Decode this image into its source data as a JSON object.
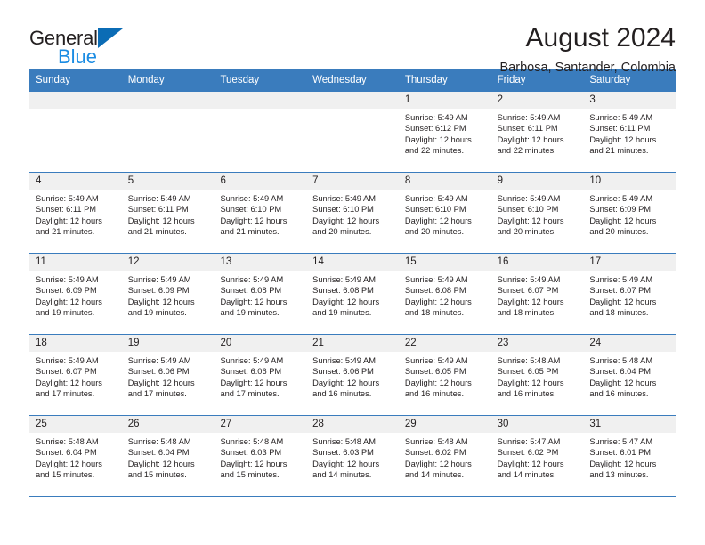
{
  "brand": {
    "name_part1": "General",
    "name_part2": "Blue",
    "flag_color": "#0b6cb5",
    "blue_text_color": "#1b8ce3"
  },
  "header": {
    "title": "August 2024",
    "subtitle": "Barbosa, Santander, Colombia"
  },
  "theme": {
    "header_band": "#3a7cbd",
    "daynum_band": "#f0f0f0",
    "text": "#231f20"
  },
  "calendar": {
    "weekdays": [
      "Sunday",
      "Monday",
      "Tuesday",
      "Wednesday",
      "Thursday",
      "Friday",
      "Saturday"
    ],
    "weeks": [
      [
        {
          "day": "",
          "sunrise": "",
          "sunset": "",
          "daylight1": "",
          "daylight2": "",
          "empty": true
        },
        {
          "day": "",
          "sunrise": "",
          "sunset": "",
          "daylight1": "",
          "daylight2": "",
          "empty": true
        },
        {
          "day": "",
          "sunrise": "",
          "sunset": "",
          "daylight1": "",
          "daylight2": "",
          "empty": true
        },
        {
          "day": "",
          "sunrise": "",
          "sunset": "",
          "daylight1": "",
          "daylight2": "",
          "empty": true
        },
        {
          "day": "1",
          "sunrise": "Sunrise: 5:49 AM",
          "sunset": "Sunset: 6:12 PM",
          "daylight1": "Daylight: 12 hours",
          "daylight2": "and 22 minutes."
        },
        {
          "day": "2",
          "sunrise": "Sunrise: 5:49 AM",
          "sunset": "Sunset: 6:11 PM",
          "daylight1": "Daylight: 12 hours",
          "daylight2": "and 22 minutes."
        },
        {
          "day": "3",
          "sunrise": "Sunrise: 5:49 AM",
          "sunset": "Sunset: 6:11 PM",
          "daylight1": "Daylight: 12 hours",
          "daylight2": "and 21 minutes."
        }
      ],
      [
        {
          "day": "4",
          "sunrise": "Sunrise: 5:49 AM",
          "sunset": "Sunset: 6:11 PM",
          "daylight1": "Daylight: 12 hours",
          "daylight2": "and 21 minutes."
        },
        {
          "day": "5",
          "sunrise": "Sunrise: 5:49 AM",
          "sunset": "Sunset: 6:11 PM",
          "daylight1": "Daylight: 12 hours",
          "daylight2": "and 21 minutes."
        },
        {
          "day": "6",
          "sunrise": "Sunrise: 5:49 AM",
          "sunset": "Sunset: 6:10 PM",
          "daylight1": "Daylight: 12 hours",
          "daylight2": "and 21 minutes."
        },
        {
          "day": "7",
          "sunrise": "Sunrise: 5:49 AM",
          "sunset": "Sunset: 6:10 PM",
          "daylight1": "Daylight: 12 hours",
          "daylight2": "and 20 minutes."
        },
        {
          "day": "8",
          "sunrise": "Sunrise: 5:49 AM",
          "sunset": "Sunset: 6:10 PM",
          "daylight1": "Daylight: 12 hours",
          "daylight2": "and 20 minutes."
        },
        {
          "day": "9",
          "sunrise": "Sunrise: 5:49 AM",
          "sunset": "Sunset: 6:10 PM",
          "daylight1": "Daylight: 12 hours",
          "daylight2": "and 20 minutes."
        },
        {
          "day": "10",
          "sunrise": "Sunrise: 5:49 AM",
          "sunset": "Sunset: 6:09 PM",
          "daylight1": "Daylight: 12 hours",
          "daylight2": "and 20 minutes."
        }
      ],
      [
        {
          "day": "11",
          "sunrise": "Sunrise: 5:49 AM",
          "sunset": "Sunset: 6:09 PM",
          "daylight1": "Daylight: 12 hours",
          "daylight2": "and 19 minutes."
        },
        {
          "day": "12",
          "sunrise": "Sunrise: 5:49 AM",
          "sunset": "Sunset: 6:09 PM",
          "daylight1": "Daylight: 12 hours",
          "daylight2": "and 19 minutes."
        },
        {
          "day": "13",
          "sunrise": "Sunrise: 5:49 AM",
          "sunset": "Sunset: 6:08 PM",
          "daylight1": "Daylight: 12 hours",
          "daylight2": "and 19 minutes."
        },
        {
          "day": "14",
          "sunrise": "Sunrise: 5:49 AM",
          "sunset": "Sunset: 6:08 PM",
          "daylight1": "Daylight: 12 hours",
          "daylight2": "and 19 minutes."
        },
        {
          "day": "15",
          "sunrise": "Sunrise: 5:49 AM",
          "sunset": "Sunset: 6:08 PM",
          "daylight1": "Daylight: 12 hours",
          "daylight2": "and 18 minutes."
        },
        {
          "day": "16",
          "sunrise": "Sunrise: 5:49 AM",
          "sunset": "Sunset: 6:07 PM",
          "daylight1": "Daylight: 12 hours",
          "daylight2": "and 18 minutes."
        },
        {
          "day": "17",
          "sunrise": "Sunrise: 5:49 AM",
          "sunset": "Sunset: 6:07 PM",
          "daylight1": "Daylight: 12 hours",
          "daylight2": "and 18 minutes."
        }
      ],
      [
        {
          "day": "18",
          "sunrise": "Sunrise: 5:49 AM",
          "sunset": "Sunset: 6:07 PM",
          "daylight1": "Daylight: 12 hours",
          "daylight2": "and 17 minutes."
        },
        {
          "day": "19",
          "sunrise": "Sunrise: 5:49 AM",
          "sunset": "Sunset: 6:06 PM",
          "daylight1": "Daylight: 12 hours",
          "daylight2": "and 17 minutes."
        },
        {
          "day": "20",
          "sunrise": "Sunrise: 5:49 AM",
          "sunset": "Sunset: 6:06 PM",
          "daylight1": "Daylight: 12 hours",
          "daylight2": "and 17 minutes."
        },
        {
          "day": "21",
          "sunrise": "Sunrise: 5:49 AM",
          "sunset": "Sunset: 6:06 PM",
          "daylight1": "Daylight: 12 hours",
          "daylight2": "and 16 minutes."
        },
        {
          "day": "22",
          "sunrise": "Sunrise: 5:49 AM",
          "sunset": "Sunset: 6:05 PM",
          "daylight1": "Daylight: 12 hours",
          "daylight2": "and 16 minutes."
        },
        {
          "day": "23",
          "sunrise": "Sunrise: 5:48 AM",
          "sunset": "Sunset: 6:05 PM",
          "daylight1": "Daylight: 12 hours",
          "daylight2": "and 16 minutes."
        },
        {
          "day": "24",
          "sunrise": "Sunrise: 5:48 AM",
          "sunset": "Sunset: 6:04 PM",
          "daylight1": "Daylight: 12 hours",
          "daylight2": "and 16 minutes."
        }
      ],
      [
        {
          "day": "25",
          "sunrise": "Sunrise: 5:48 AM",
          "sunset": "Sunset: 6:04 PM",
          "daylight1": "Daylight: 12 hours",
          "daylight2": "and 15 minutes."
        },
        {
          "day": "26",
          "sunrise": "Sunrise: 5:48 AM",
          "sunset": "Sunset: 6:04 PM",
          "daylight1": "Daylight: 12 hours",
          "daylight2": "and 15 minutes."
        },
        {
          "day": "27",
          "sunrise": "Sunrise: 5:48 AM",
          "sunset": "Sunset: 6:03 PM",
          "daylight1": "Daylight: 12 hours",
          "daylight2": "and 15 minutes."
        },
        {
          "day": "28",
          "sunrise": "Sunrise: 5:48 AM",
          "sunset": "Sunset: 6:03 PM",
          "daylight1": "Daylight: 12 hours",
          "daylight2": "and 14 minutes."
        },
        {
          "day": "29",
          "sunrise": "Sunrise: 5:48 AM",
          "sunset": "Sunset: 6:02 PM",
          "daylight1": "Daylight: 12 hours",
          "daylight2": "and 14 minutes."
        },
        {
          "day": "30",
          "sunrise": "Sunrise: 5:47 AM",
          "sunset": "Sunset: 6:02 PM",
          "daylight1": "Daylight: 12 hours",
          "daylight2": "and 14 minutes."
        },
        {
          "day": "31",
          "sunrise": "Sunrise: 5:47 AM",
          "sunset": "Sunset: 6:01 PM",
          "daylight1": "Daylight: 12 hours",
          "daylight2": "and 13 minutes."
        }
      ]
    ]
  }
}
